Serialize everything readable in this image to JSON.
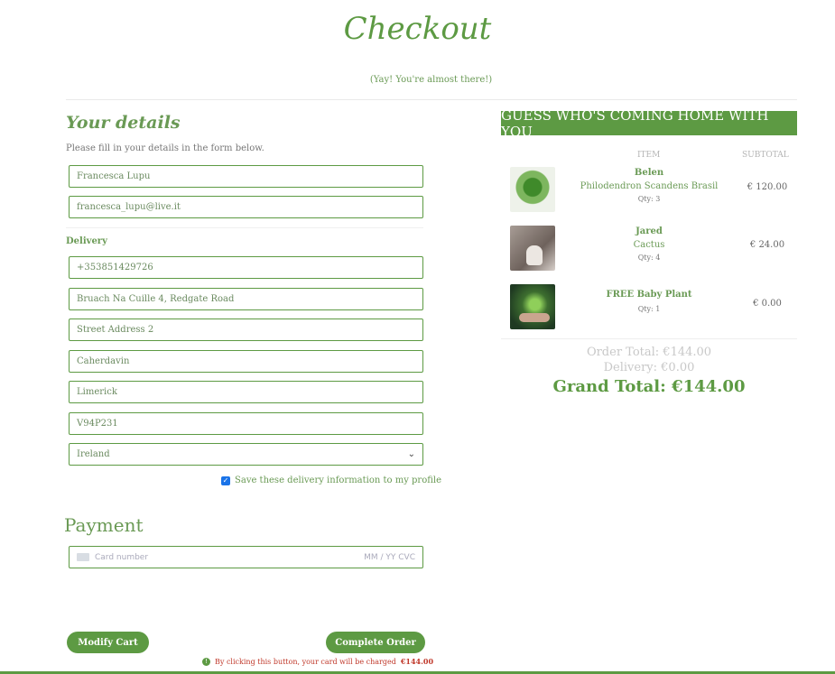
{
  "page": {
    "title": "Checkout",
    "subtitle": "(Yay! You're almost there!)"
  },
  "details": {
    "heading": "Your details",
    "help": "Please fill in your details in the form below.",
    "full_name": "Francesca Lupu",
    "email": "francesca_lupu@live.it"
  },
  "delivery": {
    "label": "Delivery",
    "phone": "+353851429726",
    "street1": "Bruach Na Cuille 4, Redgate Road",
    "street2_placeholder": "Street Address 2",
    "town": "Caherdavin",
    "county": "Limerick",
    "postcode": "V94P231",
    "country": "Ireland",
    "save_label": "Save these delivery information to my profile",
    "save_checked": true
  },
  "payment": {
    "heading": "Payment",
    "card_placeholder": "Card number",
    "card_right": "MM / YY  CVC"
  },
  "actions": {
    "modify_label": "Modify Cart",
    "complete_label": "Complete Order",
    "charge_note": "By clicking this button, your card will be charged",
    "charge_amount": "€144.00"
  },
  "summary": {
    "banner": "GUESS WHO'S COMING HOME WITH YOU",
    "col_item": "ITEM",
    "col_subtotal": "SUBTOTAL",
    "items": [
      {
        "name": "Belen",
        "desc": "Philodendron Scandens Brasil",
        "qty": "Qty: 3",
        "price": "€ 120.00"
      },
      {
        "name": "Jared",
        "desc": "Cactus",
        "qty": "Qty: 4",
        "price": "€ 24.00"
      },
      {
        "name": "FREE Baby Plant",
        "desc": "",
        "qty": "Qty: 1",
        "price": "€ 0.00"
      }
    ],
    "order_total": "Order Total: €144.00",
    "delivery_total": "Delivery: €0.00",
    "grand_total": "Grand Total: €144.00"
  },
  "colors": {
    "brand_green": "#5d9a43",
    "charge_red": "#c0392b"
  },
  "icons": {
    "checkbox": "check-icon",
    "info": "info-icon",
    "select": "chevron-down-icon",
    "card": "card-icon"
  }
}
